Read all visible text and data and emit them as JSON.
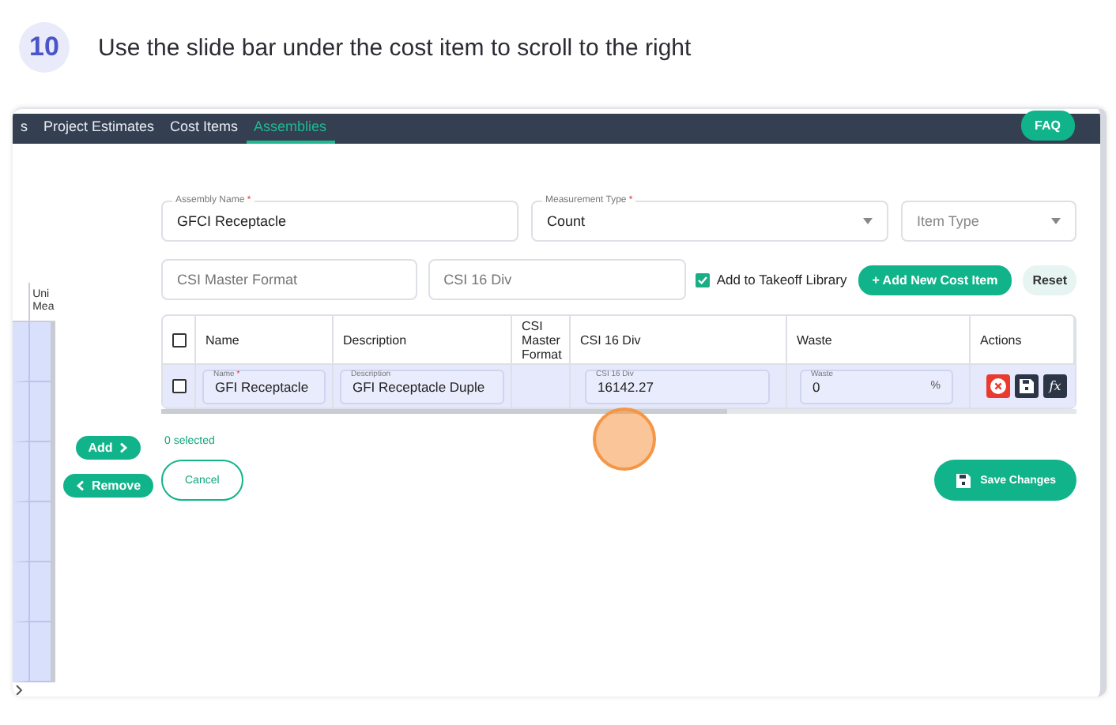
{
  "step": {
    "number": "10",
    "text": "Use the slide bar under the cost item to scroll to the right"
  },
  "nav": {
    "tabs": [
      {
        "label": "s",
        "selected": false
      },
      {
        "label": "Project Estimates",
        "selected": false
      },
      {
        "label": "Cost Items",
        "selected": false
      },
      {
        "label": "Assemblies",
        "selected": true
      }
    ],
    "faq": "FAQ"
  },
  "left_table": {
    "header_lines": [
      "Uni",
      "Mea"
    ]
  },
  "side_buttons": {
    "add": "Add",
    "remove": "Remove"
  },
  "form": {
    "assembly_name": {
      "label": "Assembly Name",
      "required_mark": "*",
      "value": "GFCI Receptacle"
    },
    "measurement_type": {
      "label": "Measurement Type",
      "required_mark": "*",
      "value": "Count"
    },
    "item_type": {
      "placeholder": "Item Type"
    },
    "csi_master_format": {
      "placeholder": "CSI Master Format"
    },
    "csi_16_div": {
      "placeholder": "CSI 16 Div"
    },
    "add_to_library": {
      "label": "Add to Takeoff Library",
      "checked": true
    },
    "add_button": "+ Add New Cost Item",
    "reset_button": "Reset"
  },
  "table": {
    "header_checked": false,
    "columns": [
      "Name",
      "Description",
      "CSI Master Format",
      "CSI 16 Div",
      "Waste",
      "Actions"
    ],
    "rows": [
      {
        "checked": false,
        "name": {
          "label": "Name",
          "required_mark": "*",
          "value": "GFI Receptacle"
        },
        "description": {
          "label": "Description",
          "value": "GFI Receptacle Duple"
        },
        "csi_16_div": {
          "label": "CSI 16 Div",
          "value": "16142.27"
        },
        "waste": {
          "label": "Waste",
          "value": "0",
          "unit": "%"
        },
        "formula_label": "fx"
      }
    ]
  },
  "selection_count": "0 selected",
  "cancel_button": "Cancel",
  "save_button": "Save Changes"
}
